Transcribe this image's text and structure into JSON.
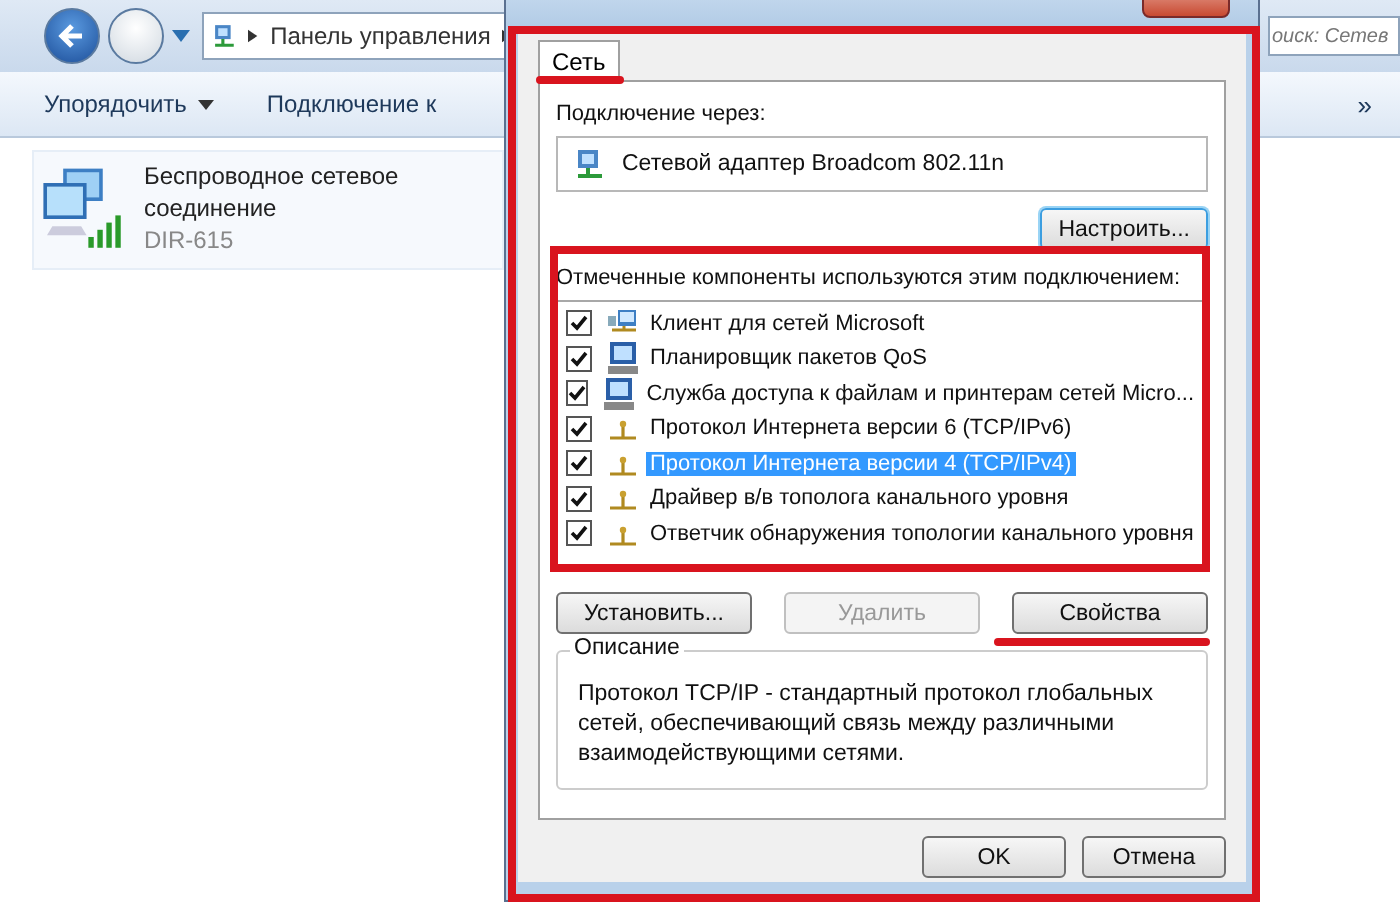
{
  "explorer": {
    "breadcrumb": "Панель управления",
    "search": {
      "placeholder": "оиск: Сетев"
    },
    "toolbar": [
      {
        "label": "Упорядочить",
        "kind": "menu"
      },
      {
        "label": "Подключение к",
        "kind": "plain"
      },
      {
        "label": "»",
        "kind": "more"
      }
    ],
    "connection": {
      "name": "Беспроводное сетевое соединение",
      "network": "DIR-615"
    }
  },
  "dialog": {
    "tabs": [
      {
        "label": "Сеть",
        "selected": true
      }
    ],
    "connect_via_label": "Подключение через:",
    "adapter": "Сетевой адаптер Broadcom 802.11n",
    "configure_button": "Настроить...",
    "components_label": "Отмеченные компоненты используются этим подключением:",
    "components": [
      {
        "label": "Клиент для сетей Microsoft",
        "kind": "client",
        "checked": true,
        "selected": false
      },
      {
        "label": "Планировщик пакетов QoS",
        "kind": "service",
        "checked": true,
        "selected": false
      },
      {
        "label": "Служба доступа к файлам и принтерам сетей Micro...",
        "kind": "service",
        "checked": true,
        "selected": false
      },
      {
        "label": "Протокол Интернета версии 6 (TCP/IPv6)",
        "kind": "protocol",
        "checked": true,
        "selected": false
      },
      {
        "label": "Протокол Интернета версии 4 (TCP/IPv4)",
        "kind": "protocol",
        "checked": true,
        "selected": true
      },
      {
        "label": "Драйвер в/в тополога канального уровня",
        "kind": "protocol",
        "checked": true,
        "selected": false
      },
      {
        "label": "Ответчик обнаружения топологии канального уровня",
        "kind": "protocol",
        "checked": true,
        "selected": false
      }
    ],
    "component_buttons": [
      {
        "label": "Установить...",
        "disabled": false
      },
      {
        "label": "Удалить",
        "disabled": true
      },
      {
        "label": "Свойства",
        "disabled": false
      }
    ],
    "description_title": "Описание",
    "description": "Протокол TCP/IP - стандартный протокол глобальных сетей, обеспечивающий связь между различными взаимодействующими сетями.",
    "footer_buttons": [
      {
        "label": "OK"
      },
      {
        "label": "Отмена"
      }
    ]
  }
}
